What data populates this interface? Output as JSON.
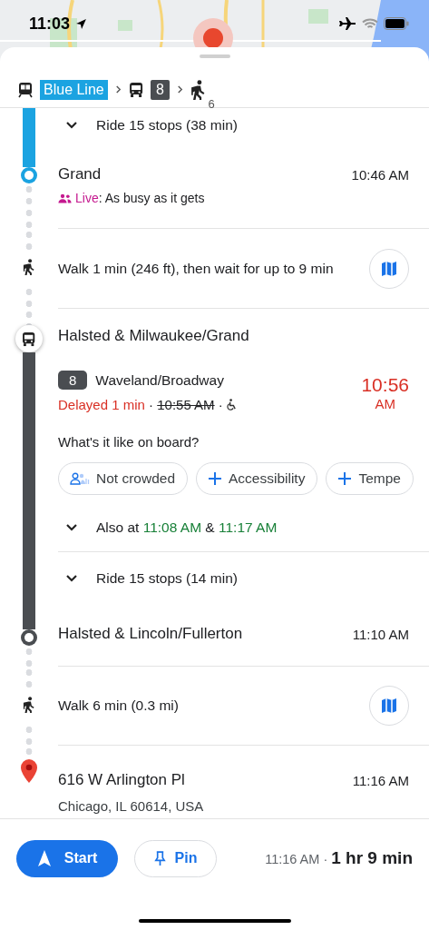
{
  "status_bar": {
    "time": "11:03"
  },
  "route": [
    {
      "kind": "rail",
      "label": "Blue Line",
      "color": "#1ba3e1"
    },
    {
      "kind": "bus",
      "label": "8",
      "color": "#4a4d51"
    },
    {
      "kind": "walk",
      "label": "6"
    }
  ],
  "steps": [
    {
      "kind": "ride",
      "color": "#1ba3e1",
      "text": "Ride 15 stops (38 min)"
    },
    {
      "kind": "arrive",
      "color": "#1ba3e1",
      "name": "Grand",
      "time": "10:46 AM",
      "live_label": "Live",
      "live_text": ": As busy as it gets"
    },
    {
      "kind": "walk",
      "text": "Walk 1 min (246 ft), then wait for up to 9 min"
    },
    {
      "kind": "board",
      "color": "#4a4d51",
      "name": "Halsted & Milwaukee/Grand"
    },
    {
      "kind": "departure",
      "color": "#4a4d51",
      "route": "8",
      "headsign": "Waveland/Broadway",
      "delay": "Delayed 1 min",
      "sep": "·",
      "scheduled": "10:55 AM",
      "time": "10:56",
      "ampm": "AM",
      "question": "What's it like on board?",
      "chips": [
        {
          "kind": "crowd",
          "label": "Not crowded"
        },
        {
          "kind": "add",
          "label": "Accessibility"
        },
        {
          "kind": "add",
          "label": "Tempe"
        }
      ]
    },
    {
      "kind": "also",
      "color": "#4a4d51",
      "prefix": "Also at",
      "times": [
        "11:08 AM",
        "11:17 AM"
      ],
      "joiner": "&"
    },
    {
      "kind": "ride",
      "color": "#4a4d51",
      "text": "Ride 15 stops (14 min)"
    },
    {
      "kind": "arrive",
      "color": "#4a4d51",
      "name": "Halsted & Lincoln/Fullerton",
      "time": "11:10 AM"
    },
    {
      "kind": "walk",
      "text": "Walk 6 min (0.3 mi)"
    },
    {
      "kind": "destination",
      "name": "616 W Arlington Pl",
      "time": "11:16 AM",
      "address": "Chicago, IL 60614, USA"
    }
  ],
  "footer": {
    "start": "Start",
    "pin": "Pin",
    "arrival": "11:16 AM",
    "sep": "·",
    "duration": "1 hr 9 min"
  }
}
